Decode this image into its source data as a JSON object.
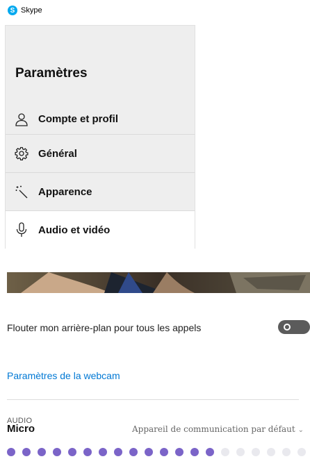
{
  "window": {
    "app_title": "Skype",
    "logo_glyph": "S"
  },
  "settings": {
    "heading": "Paramètres",
    "items": [
      {
        "label": "Compte et profil",
        "icon": "person-icon",
        "active": false
      },
      {
        "label": "Général",
        "icon": "gear-icon",
        "active": false
      },
      {
        "label": "Apparence",
        "icon": "magic-wand-icon",
        "active": false
      },
      {
        "label": "Audio et vidéo",
        "icon": "microphone-icon",
        "active": true
      }
    ]
  },
  "video": {
    "blur_label": "Flouter mon arrière-plan pour tous les appels",
    "blur_enabled": false,
    "webcam_settings_link": "Paramètres de la webcam"
  },
  "audio": {
    "section_label": "AUDIO",
    "mic_label": "Micro",
    "mic_device": "Appareil de communication par défaut",
    "mic_level_active": 14,
    "mic_level_total": 20
  },
  "colors": {
    "accent": "#0078d4",
    "skype_blue": "#00a9ef",
    "level_active": "#7b64c8",
    "level_inactive": "#e9e9ee"
  }
}
